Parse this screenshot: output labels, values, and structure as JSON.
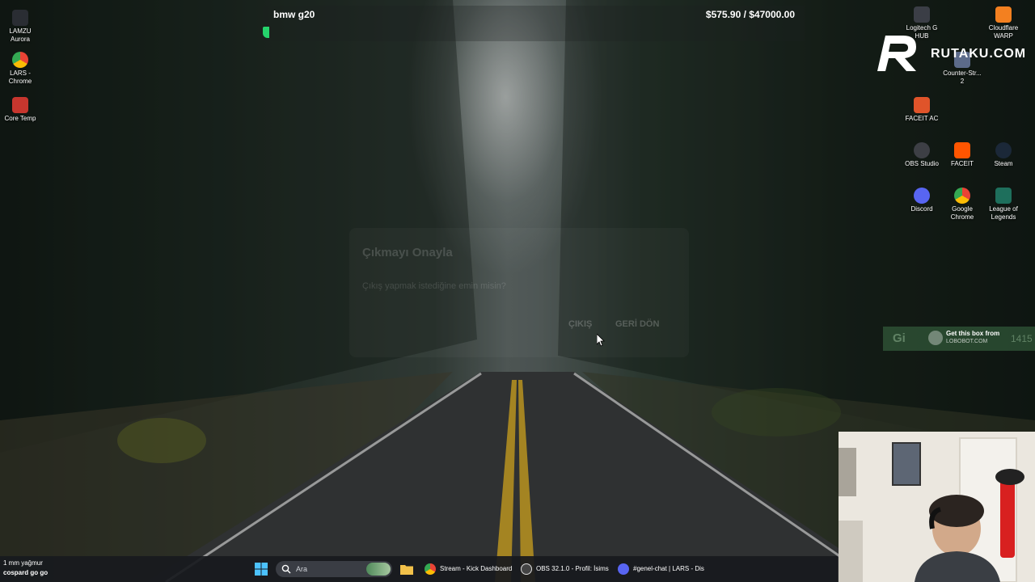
{
  "topbar": {
    "title": "bmw g20",
    "value": "$575.90 / $47000.00",
    "progress": 0.0123,
    "progress_color": "#25d36b"
  },
  "modal": {
    "title": "Çıkmayı Onayla",
    "message": "Çıkış yapmak istediğine emin misin?",
    "exit_label": "ÇIKIŞ",
    "back_label": "GERİ DÖN"
  },
  "desktop_left": [
    {
      "label": "LAMZU\nAurora",
      "icon": "lamzu-icon"
    },
    {
      "label": "LARS -\nChrome",
      "icon": "chrome-icon"
    },
    {
      "label": "Core Temp",
      "icon": "core-temp-icon"
    }
  ],
  "desktop_right": [
    {
      "label": "Logitech G\nHUB",
      "icon": "logitech-icon"
    },
    {
      "label": "Cloudflare\nWARP",
      "icon": "cloudflare-icon"
    },
    {
      "label": "Counter-Str...\n2",
      "icon": "counter-strike-icon"
    },
    {
      "label": "FACEIT AC",
      "icon": "faceit-ac-icon"
    },
    {
      "label": "OBS Studio",
      "icon": "obs-icon"
    },
    {
      "label": "FACEIT",
      "icon": "faceit-icon"
    },
    {
      "label": "Steam",
      "icon": "steam-icon"
    },
    {
      "label": "Discord",
      "icon": "discord-icon"
    },
    {
      "label": "Google\nChrome",
      "icon": "chrome-icon"
    },
    {
      "label": "League of\nLegends",
      "icon": "league-icon"
    }
  ],
  "brand": {
    "text": "RUTAKU.COM"
  },
  "lobobox": {
    "faint_text": "Gi",
    "faint_num": "1415",
    "line1": "Get this box from",
    "line2": "LOBOBOT.COM"
  },
  "taskbar": {
    "weather_temp": "1 mm yağmur",
    "weather_label": "cospard go go",
    "search_placeholder": "Ara",
    "items": [
      {
        "label": "Stream - Kick Dashboard",
        "icon": "chrome-icon"
      },
      {
        "label": "OBS 32.1.0 - Profil: İsims",
        "icon": "obs-icon"
      },
      {
        "label": "#genel-chat | LARS - Dis",
        "icon": "discord-icon"
      }
    ]
  },
  "colors": {
    "accent_green": "#25d36b",
    "taskbar_bg": "#181a1e"
  }
}
